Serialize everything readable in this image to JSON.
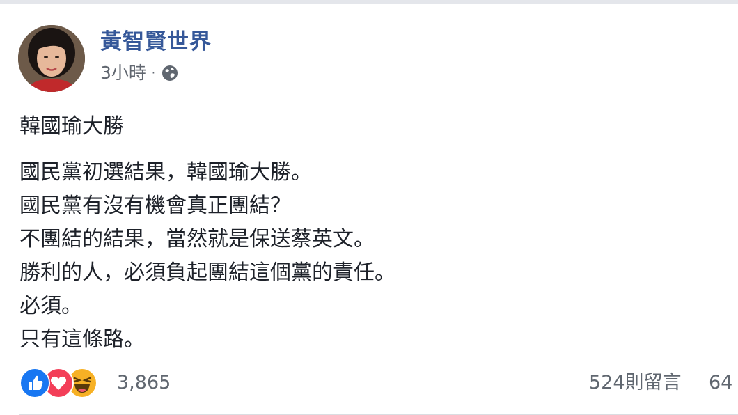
{
  "post": {
    "author": "黃智賢世界",
    "time": "3小時",
    "dot": "·",
    "title": "韓國瑜大勝",
    "lines": [
      "國民黨初選結果，韓國瑜大勝。",
      "國民黨有沒有機會真正團結？",
      "不團結的結果，當然就是保送蔡英文。",
      "勝利的人，必須負起團結這個黨的責任。",
      "必須。",
      "只有這條路。"
    ]
  },
  "footer": {
    "reaction_count": "3,865",
    "comments": "524則留言",
    "shares": "64"
  },
  "icons": {
    "privacy": "globe-icon",
    "reactions": [
      "like-icon",
      "love-icon",
      "haha-icon"
    ]
  },
  "colors": {
    "author": "#365899",
    "like": "#1877f2",
    "love": "#f33e58",
    "haha": "#f7b125"
  }
}
